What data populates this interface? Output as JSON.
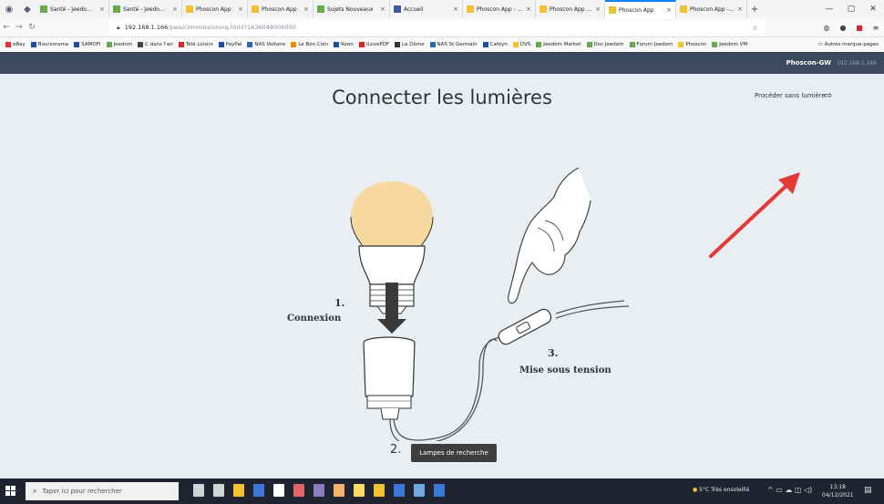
{
  "browser": {
    "tabs": [
      {
        "title": "Santé - Jeedom Dv",
        "color": "#6aa84f"
      },
      {
        "title": "Santé - Jeedom Dv",
        "color": "#6aa84f"
      },
      {
        "title": "Phoscon App",
        "color": "#f1c232"
      },
      {
        "title": "Phoscon App",
        "color": "#f1c232"
      },
      {
        "title": "Sujets Nouveaux",
        "color": "#6aa84f"
      },
      {
        "title": "Accueil",
        "color": "#3d5a99"
      },
      {
        "title": "Phoscon App - Log",
        "color": "#f1c232"
      },
      {
        "title": "Phoscon App - Log",
        "color": "#f1c232"
      },
      {
        "title": "Phoscon App",
        "color": "#f1c232"
      },
      {
        "title": "Phoscon App - Log",
        "color": "#f1c232"
      }
    ],
    "active_tab_index": 8,
    "url_host": "192.168.1.166",
    "url_path": "/pwa/commissioning.html?1636048006000",
    "bookmarks": [
      {
        "label": "eBay",
        "color": "#e53238"
      },
      {
        "label": "Boursorama",
        "color": "#1a4fa0"
      },
      {
        "label": "SAMOFI",
        "color": "#1a4fa0"
      },
      {
        "label": "Jeedom",
        "color": "#6aa84f"
      },
      {
        "label": "C dans l'air",
        "color": "#444444"
      },
      {
        "label": "Télé Loisirs",
        "color": "#d9232d"
      },
      {
        "label": "PayPal",
        "color": "#1a4fa0"
      },
      {
        "label": "NAS Voltaire",
        "color": "#2b6cb0"
      },
      {
        "label": "Le Bon Coin",
        "color": "#f08c00"
      },
      {
        "label": "Roon",
        "color": "#1a4fa0"
      },
      {
        "label": "iLovePDF",
        "color": "#d9232d"
      },
      {
        "label": "Le Dôme",
        "color": "#333333"
      },
      {
        "label": "NAS St Germain",
        "color": "#2b6cb0"
      },
      {
        "label": "Cafeyn",
        "color": "#1a4fa0"
      },
      {
        "label": "DVS",
        "color": "#f1c232"
      },
      {
        "label": "Jeedom Market",
        "color": "#6aa84f"
      },
      {
        "label": "Doc Jeedom",
        "color": "#6aa84f"
      },
      {
        "label": "Forum Jeedom",
        "color": "#6aa84f"
      },
      {
        "label": "Phoscon",
        "color": "#f1c232"
      },
      {
        "label": "Jeedom VM",
        "color": "#6aa84f"
      }
    ],
    "bookmarks_other": "Autres marque-pages"
  },
  "app_header": {
    "gateway_name": "Phoscon-GW",
    "gateway_ip": "192.168.1.166"
  },
  "page": {
    "title": "Connecter les lumières",
    "skip_link": "Procéder sans lumière",
    "step1_number": "1.",
    "step1_label": "Connexion",
    "step3_number": "3.",
    "step3_label": "Mise sous tension",
    "step2_number": "2.",
    "search_button": "Lampes de recherche",
    "bulb_color": "#f7d9a0"
  },
  "taskbar": {
    "search_placeholder": "Taper ici pour rechercher",
    "weather": "5°C Très ensoleillé",
    "time": "13:18",
    "date": "04/12/2021"
  }
}
